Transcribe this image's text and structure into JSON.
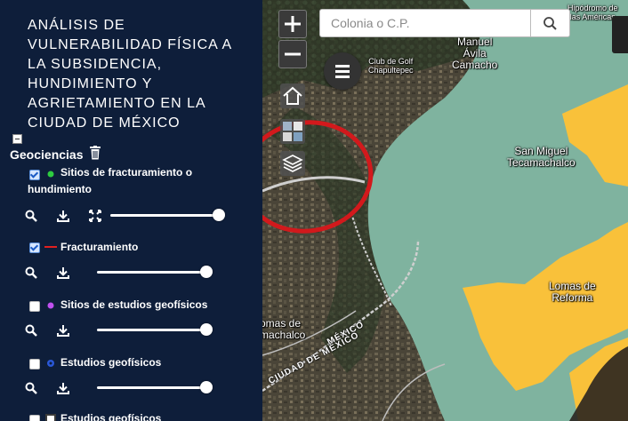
{
  "sidebar": {
    "title": "ANÁLISIS DE VULNERABILIDAD FÍSICA A LA SUBSIDENCIA, HUNDIMIENTO Y AGRIETAMIENTO EN LA CIUDAD DE MÉXICO",
    "group": {
      "title": "Geociencias",
      "layers": [
        {
          "label": "Sitios de fracturamiento o hundimiento",
          "checked": true,
          "symbol_color": "#2ecc40",
          "opacity": 1.0
        },
        {
          "label": "Fracturamiento",
          "checked": true,
          "symbol_color": "#e02020",
          "opacity": 1.0
        },
        {
          "label": "Sitios de estudios geofísicos",
          "checked": false,
          "symbol_color": "#c050f0",
          "opacity": 1.0
        },
        {
          "label": "Estudios geofísicos",
          "checked": false,
          "symbol_color": "#2a58d8",
          "opacity": 1.0
        },
        {
          "label": "Estudios geofísicos",
          "checked": false,
          "symbol_color": "#3a3a3a",
          "opacity": 1.0
        }
      ],
      "icons": [
        "zoom-icon",
        "download-icon",
        "extent-icon",
        "trash-icon"
      ]
    }
  },
  "search": {
    "placeholder": "Colonia o C.P.",
    "icon": "search-icon"
  },
  "map": {
    "controls": [
      "zoom-in-icon",
      "zoom-out-icon",
      "menu-icon",
      "home-icon",
      "basemap-icon",
      "layers-icon"
    ],
    "labels": {
      "manuel_avila": "Manuel\nÁvila\nCamacho",
      "club_golf": "Club de Golf\nChapultepec",
      "san_miguel": "San Miguel\nTecamachalco",
      "lomas_reforma": "Lomas de\nReforma",
      "lomas_tecamachalco": "omas de\nmachalco",
      "hipodromo": "Hipódromo de\nlas Américas",
      "road1": "MÉXICO",
      "road2": "CIUDAD DE MÉXICO"
    },
    "colors": {
      "zone_green": "#7fb39f",
      "zone_yellow": "#f9c13a",
      "annotation_red": "#d2191c",
      "sidebar_bg": "#0e1e3a"
    }
  }
}
